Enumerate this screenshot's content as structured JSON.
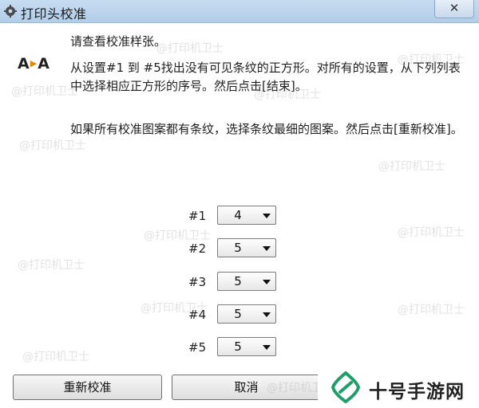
{
  "window": {
    "title": "打印头校准",
    "close_label": "✕"
  },
  "icon": {
    "aa_left": "A",
    "aa_right": "A"
  },
  "instructions": {
    "line1": "请查看校准样张。",
    "line2": "从设置#1 到 #5找出没有可见条纹的正方形。对所有的设置，从下列列表中选择相应正方形的序号。然后点击[结束]。",
    "line3": "如果所有校准图案都有条纹，选择条纹最细的图案。然后点击[重新校准]。"
  },
  "settings": [
    {
      "label": "#1",
      "value": "4"
    },
    {
      "label": "#2",
      "value": "5"
    },
    {
      "label": "#3",
      "value": "5"
    },
    {
      "label": "#4",
      "value": "5"
    },
    {
      "label": "#5",
      "value": "5"
    }
  ],
  "buttons": {
    "recalibrate": "重新校准",
    "cancel": "取消"
  },
  "watermark": "@打印机卫士",
  "brand": {
    "name": "十号手游网",
    "accent": "#1f9e6a"
  }
}
